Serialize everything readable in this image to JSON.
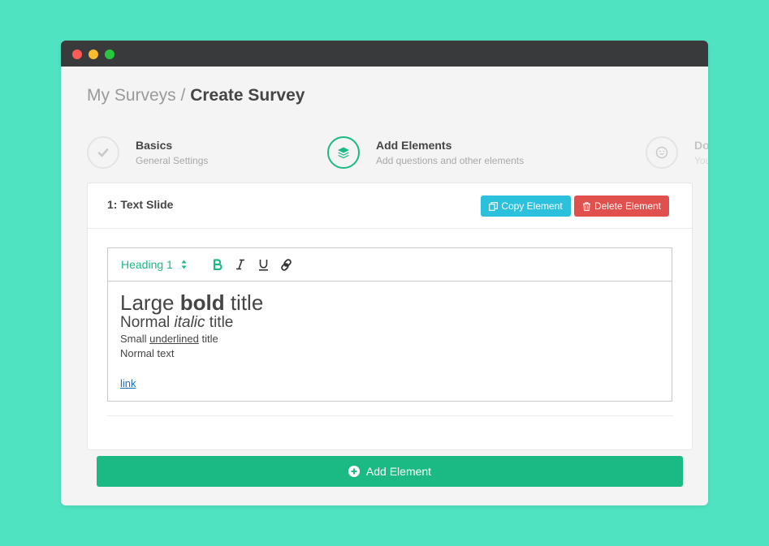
{
  "window": {
    "controls": [
      "close",
      "minimize",
      "maximize"
    ]
  },
  "breadcrumb": {
    "parent": "My Surveys",
    "separator": " / ",
    "current": "Create Survey"
  },
  "steps": [
    {
      "title": "Basics",
      "subtitle": "General Settings",
      "icon": "check-icon",
      "state": "done"
    },
    {
      "title": "Add Elements",
      "subtitle": "Add questions and other elements",
      "icon": "layers-icon",
      "state": "active"
    },
    {
      "title": "Do",
      "subtitle": "You",
      "icon": "smile-icon",
      "state": "upcoming"
    }
  ],
  "card": {
    "title": "1: Text Slide",
    "copy_label": "Copy Element",
    "delete_label": "Delete Element"
  },
  "editor": {
    "heading_select": "Heading 1",
    "toolbar": [
      "bold-icon",
      "italic-icon",
      "underline-icon",
      "link-icon"
    ],
    "line1": {
      "pre": "Large ",
      "bold": "bold",
      "post": " title"
    },
    "line2": {
      "pre": "Normal ",
      "italic": "italic",
      "post": " title"
    },
    "line3": {
      "pre": "Small ",
      "underlined": "underlined",
      "post": " title"
    },
    "line4": "Normal text",
    "link": "link"
  },
  "add_element_label": "Add Element",
  "colors": {
    "background": "#50e3c2",
    "accent": "#1bb983",
    "copy": "#2bc0dc",
    "delete": "#e0504d",
    "titlebar": "#383a3c"
  }
}
